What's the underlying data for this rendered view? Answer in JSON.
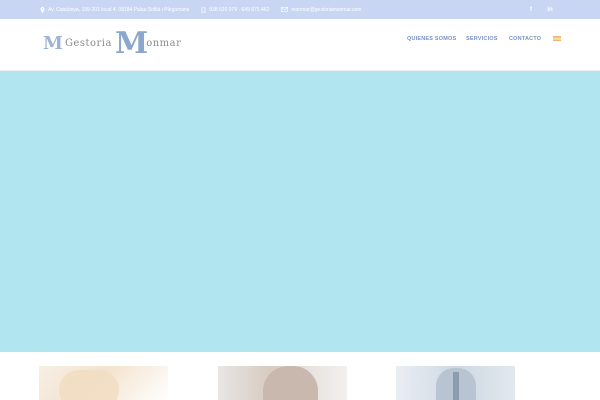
{
  "topbar": {
    "address": "Av. Catalunya, 199-201 local 4, 08184 Palau Solità i Plegamans",
    "phones": "938 620 979 - 649 875 462",
    "email": "monmar@gestoriamonmar.com",
    "facebook_label": "f",
    "linkedin_label": "in",
    "bg_color": "#c8d6f3"
  },
  "header": {
    "logo_text_left": "Gestoria",
    "logo_text_right": "onmar",
    "logo_mark": "M",
    "logo_big_m": "M",
    "nav": [
      {
        "label": "QUIENES SOMOS"
      },
      {
        "label": "SERVICIOS"
      },
      {
        "label": "CONTACTO"
      }
    ],
    "nav_color": "#7a90c2",
    "language_flag": "spanish-flag-icon"
  },
  "hero": {
    "bg_color": "#b1e6f0"
  },
  "thumbnails": [
    {
      "icon": "office-photo"
    },
    {
      "icon": "meeting-photo"
    },
    {
      "icon": "businessman-photo"
    }
  ]
}
